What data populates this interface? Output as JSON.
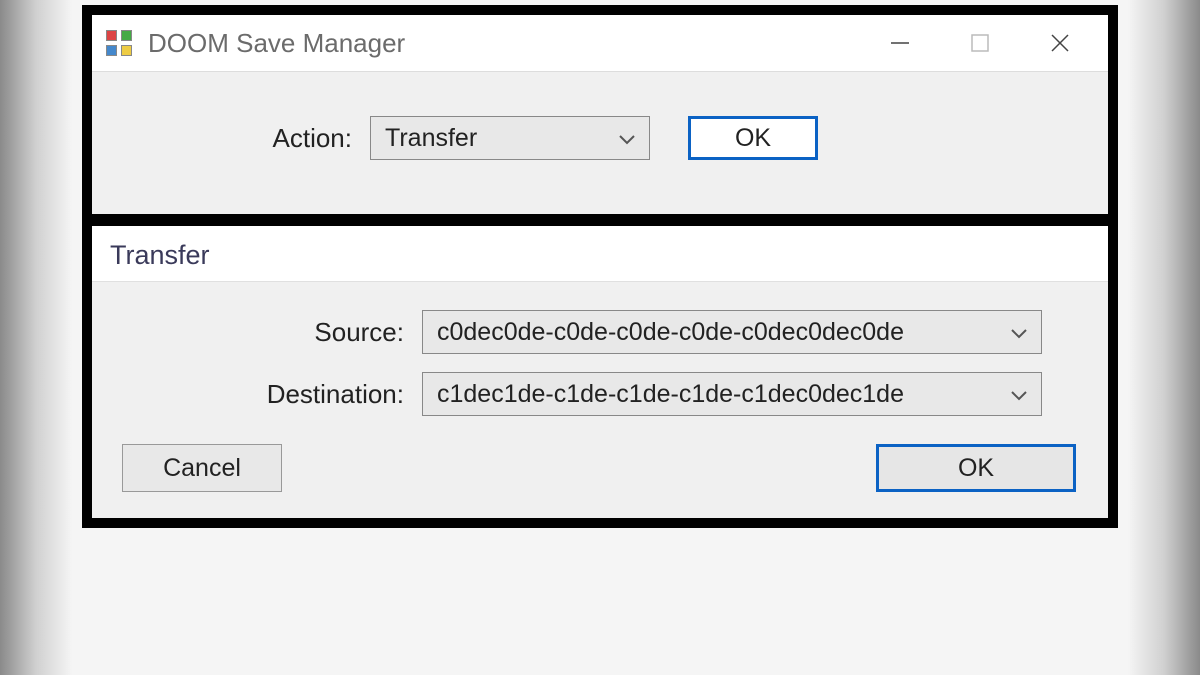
{
  "window": {
    "title": "DOOM Save Manager"
  },
  "action_panel": {
    "label": "Action:",
    "selected": "Transfer",
    "ok_label": "OK"
  },
  "transfer_panel": {
    "header": "Transfer",
    "source_label": "Source:",
    "source_value": "c0dec0de-c0de-c0de-c0de-c0dec0dec0de",
    "destination_label": "Destination:",
    "destination_value": "c1dec1de-c1de-c1de-c1de-c1dec0dec1de",
    "cancel_label": "Cancel",
    "ok_label": "OK"
  }
}
